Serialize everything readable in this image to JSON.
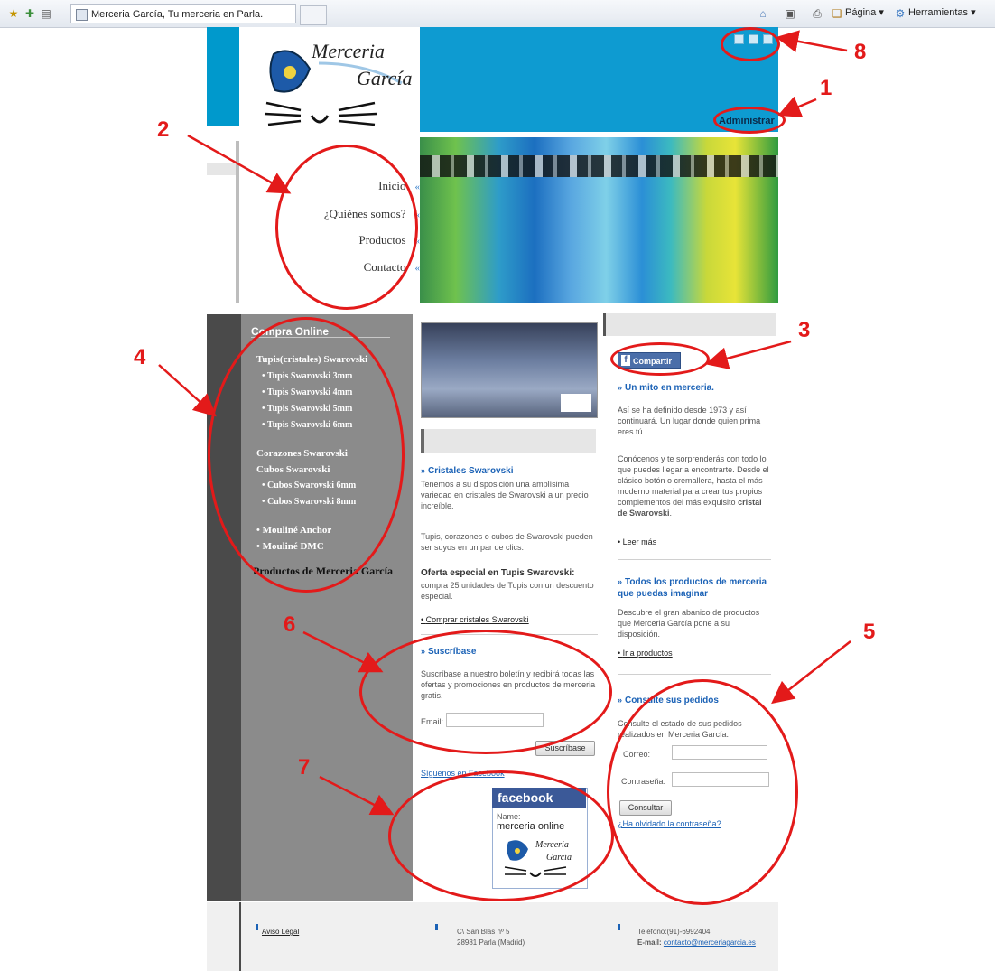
{
  "browser": {
    "tab_title": "Merceria García, Tu merceria en Parla.",
    "menu_pagina": "Página",
    "menu_herramientas": "Herramientas"
  },
  "header": {
    "logo_line1": "Merceria",
    "logo_line2": "García",
    "admin_label": "Administrar"
  },
  "nav": {
    "items": [
      {
        "label": "Inicio",
        "chevron": "«"
      },
      {
        "label": "¿Quiénes somos?",
        "chevron": "«"
      },
      {
        "label": "Productos",
        "chevron": "«"
      },
      {
        "label": "Contacto",
        "chevron": "«"
      }
    ]
  },
  "sidebar": {
    "title": "Compra Online",
    "groups": [
      {
        "label": "Tupis(cristales) Swarovski",
        "items": [
          "Tupis Swarovski 3mm",
          "Tupis Swarovski 4mm",
          "Tupis Swarovski 5mm",
          "Tupis Swarovski 6mm"
        ]
      },
      {
        "label": "Corazones Swarovski",
        "items": []
      },
      {
        "label": "Cubos Swarovski",
        "items": [
          "Cubos Swarovski 6mm",
          "Cubos Swarovski 8mm"
        ]
      },
      {
        "label": "",
        "items": [
          "Mouliné Anchor",
          "Mouliné DMC"
        ]
      }
    ],
    "footer_label": "Productos de Merceria García",
    "bullet": "•"
  },
  "center": {
    "cristales_title": "Cristales Swarovski",
    "cristales_p1": "Tenemos a su disposición una amplísima variedad en cristales de Swarovski a un precio increíble.",
    "cristales_p2": "Tupis, corazones o cubos de Swarovski pueden ser suyos en un par de clics.",
    "oferta_title": "Oferta especial en Tupis Swarovski:",
    "oferta_text": "compra 25 unidades de Tupis con un descuento especial.",
    "comprar_link": "Comprar cristales Swarovski",
    "suscribase_title": "Suscríbase",
    "suscribase_text": "Suscríbase a nuestro boletín y recibirá todas las ofertas y promociones en productos de merceria gratis.",
    "email_label": "Email:",
    "suscribase_button": "Suscríbase",
    "siguenos_link": "Síguenos en Facebook",
    "fb_brand": "facebook",
    "fb_name_label": "Name:",
    "fb_name_value": "merceria online"
  },
  "right": {
    "share_label": "Compartir",
    "mito_title": "Un mito en merceria.",
    "mito_p1": "Así se ha definido desde 1973 y así continuará. Un lugar donde quien prima eres tú.",
    "mito_p2a": "Conócenos y te sorprenderás con todo lo que puedes llegar a encontrarte. Desde el clásico botón o cremallera, hasta el más moderno material para crear tus propios complementos del más exquisito",
    "mito_p2b": "cristal de Swarovski",
    "leer_mas": "Leer más",
    "todos_title": "Todos los productos de merceria que puedas imaginar",
    "todos_text": "Descubre el gran abanico de productos que Merceria García pone a su disposición.",
    "ir_productos": "Ir a productos",
    "pedidos_title": "Consulte sus pedidos",
    "pedidos_text": "Consulte el estado de sus pedidos realizados en Merceria García.",
    "correo_label": "Correo:",
    "contrasena_label": "Contraseña:",
    "consultar_button": "Consultar",
    "olvidado_link": "¿Ha olvidado la contraseña?"
  },
  "footer": {
    "aviso": "Aviso Legal",
    "address1": "C\\ San Blas nº 5",
    "address2": "28981 Parla (Madrid)",
    "phone": "Teléfono:(91)-6992404",
    "email_label": "E-mail:",
    "email_value": "contacto@merceriagarcia.es"
  },
  "annotations": [
    "1",
    "2",
    "3",
    "4",
    "5",
    "6",
    "7",
    "8"
  ],
  "colors": {
    "annotation": "#e31a1a",
    "banner": "#0e9bd1",
    "link": "#1b62b6",
    "sidebar": "#8b8b8b"
  }
}
